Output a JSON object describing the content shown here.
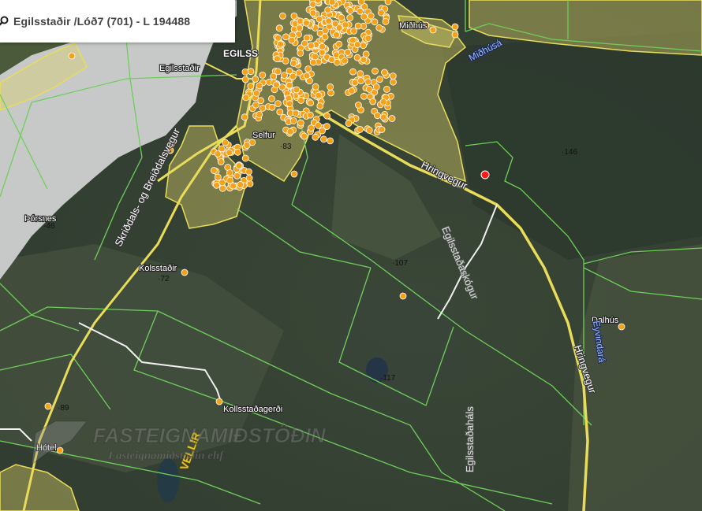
{
  "search": {
    "text": "Egilsstaðir  /Lóð7 (701) - L 194488",
    "icon": "search-icon"
  },
  "places": {
    "egilsstadir_top": "EGILSS",
    "egilsstadir": "Egilsstaðir",
    "midhus": "Miðhús",
    "thorsnes": "Þórsnes",
    "kolsstadir": "Kolsstaðir",
    "dalhus": "Dalhús",
    "kollsstadagerdi": "Kollsstaðagerði",
    "hotel": "Hótel",
    "selfur": "Selfur"
  },
  "roads": {
    "hringvegur_1": "Hringvegur",
    "hringvegur_2": "Hringvegur",
    "skriddals": "Skriðdals- og Breiðdalsvegur",
    "egilsstadaskogur": "Egilsstaðaskógur",
    "egilsstadahals": "Egilsstaðaháls",
    "vellir": "VELLIR"
  },
  "rivers": {
    "eyvindara": "Eyvindará",
    "midhusa": "Miðhúsá"
  },
  "elevations": [
    "146",
    "83",
    "46",
    "72",
    "107",
    "117",
    "89"
  ],
  "watermark": {
    "title": "FASTEIGNAMIÐSTÖÐIN",
    "subtitle": "Fasteignamiðstöðin ehf"
  },
  "colors": {
    "parcel_fill": "#d8d06a",
    "parcel_stroke": "#e8dc5a",
    "boundary": "#6ecf5a",
    "address_point": "#f5a11a",
    "selected_point": "#ff1a1a",
    "water": "#c7c9c8"
  }
}
